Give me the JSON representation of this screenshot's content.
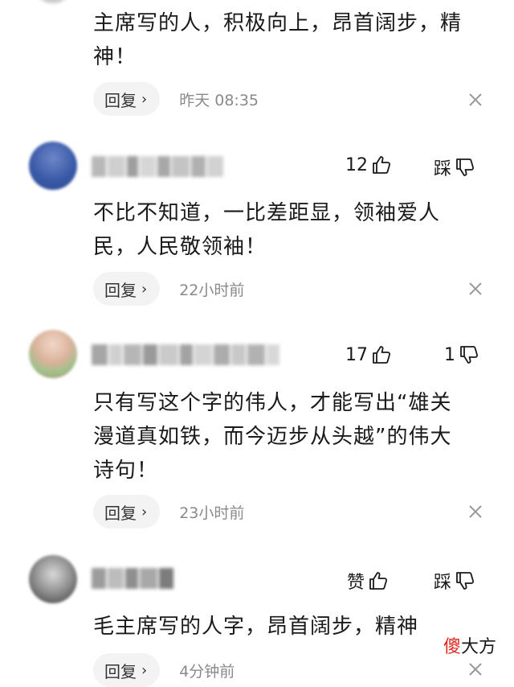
{
  "comments": [
    {
      "text_lines": [
        "主席写的人，积极向上，昂首阔步，精",
        "神！"
      ],
      "reply_label": "回复",
      "time": "昨天 08:35"
    },
    {
      "likes": "12",
      "dislike_label": "踩",
      "text_lines": [
        "不比不知道，一比差距显，领袖爱人",
        "民，人民敬领袖！"
      ],
      "reply_label": "回复",
      "time": "22小时前"
    },
    {
      "likes": "17",
      "dislikes": "1",
      "text_lines": [
        "只有写这个字的伟人，才能写出“雄关",
        "漫道真如铁，而今迈步从头越”的伟大",
        "诗句！"
      ],
      "reply_label": "回复",
      "time": "23小时前"
    },
    {
      "like_label": "赞",
      "dislike_label": "踩",
      "text_lines": [
        "毛主席写的人字，昂首阔步，精神"
      ],
      "reply_label": "回复",
      "time": "4分钟前"
    }
  ],
  "icons": {
    "like": "thumbs-up-icon",
    "dislike": "thumbs-down-icon",
    "close": "close-icon",
    "chevron": "chevron-right-icon"
  },
  "watermark": {
    "red_char": "傻",
    "rest": "大方"
  },
  "colors": {
    "text": "#1a1a1a",
    "muted": "#8a8a8a",
    "pill_bg": "#f3f3f3",
    "watermark_red": "#e0261b"
  }
}
